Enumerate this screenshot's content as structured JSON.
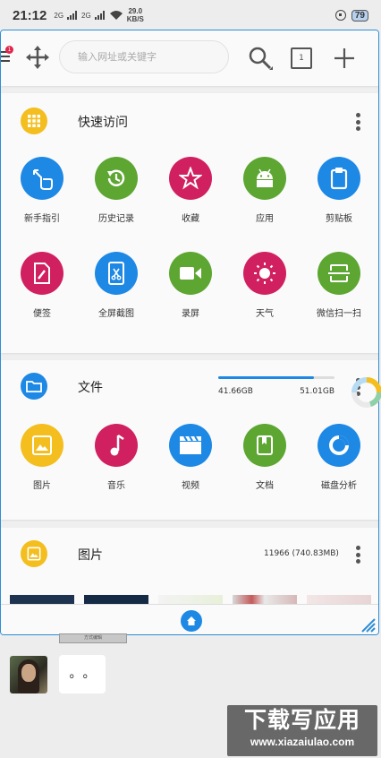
{
  "status_bar": {
    "time": "21:12",
    "sim1": "2G",
    "sim2": "2G",
    "net_speed": "29.0",
    "net_unit": "KB/S",
    "battery": "79"
  },
  "topbar": {
    "search_placeholder": "输入网址或关键字",
    "notification_badge": "1",
    "tabs_count": "1"
  },
  "quick_access": {
    "title": "快速访问",
    "items": [
      {
        "label": "新手指引",
        "icon": "hand-pointer-icon",
        "color": "#1e88e5"
      },
      {
        "label": "历史记录",
        "icon": "history-icon",
        "color": "#5da632"
      },
      {
        "label": "收藏",
        "icon": "star-icon",
        "color": "#d0205f"
      },
      {
        "label": "应用",
        "icon": "android-icon",
        "color": "#5da632"
      },
      {
        "label": "剪贴板",
        "icon": "clipboard-icon",
        "color": "#1e88e5"
      },
      {
        "label": "便签",
        "icon": "note-edit-icon",
        "color": "#d0205f"
      },
      {
        "label": "全屏截图",
        "icon": "screenshot-icon",
        "color": "#1e88e5"
      },
      {
        "label": "录屏",
        "icon": "video-camera-icon",
        "color": "#5da632"
      },
      {
        "label": "天气",
        "icon": "sun-icon",
        "color": "#d0205f"
      },
      {
        "label": "微信扫一扫",
        "icon": "scan-icon",
        "color": "#5da632"
      }
    ]
  },
  "files": {
    "title": "文件",
    "used": "41.66GB",
    "total": "51.01GB",
    "used_fraction": 0.82,
    "items": [
      {
        "label": "图片",
        "icon": "image-icon",
        "color": "#f4be1e"
      },
      {
        "label": "音乐",
        "icon": "music-note-icon",
        "color": "#d0205f"
      },
      {
        "label": "视频",
        "icon": "clapperboard-icon",
        "color": "#1e88e5"
      },
      {
        "label": "文档",
        "icon": "document-icon",
        "color": "#5da632"
      },
      {
        "label": "磁盘分析",
        "icon": "disk-analysis-icon",
        "color": "#1e88e5"
      }
    ]
  },
  "pictures": {
    "title": "图片",
    "count": "11966 (740.83MB)"
  },
  "chat": {
    "photo_caption": "方式编辑",
    "bubble": "。。"
  },
  "watermark": {
    "line1": "下载写应用",
    "line2": "www.xiazaiulao.com"
  },
  "colors": {
    "accent": "#1e88e5",
    "green": "#5da632",
    "pink": "#d0205f",
    "yellow": "#f4be1e"
  }
}
